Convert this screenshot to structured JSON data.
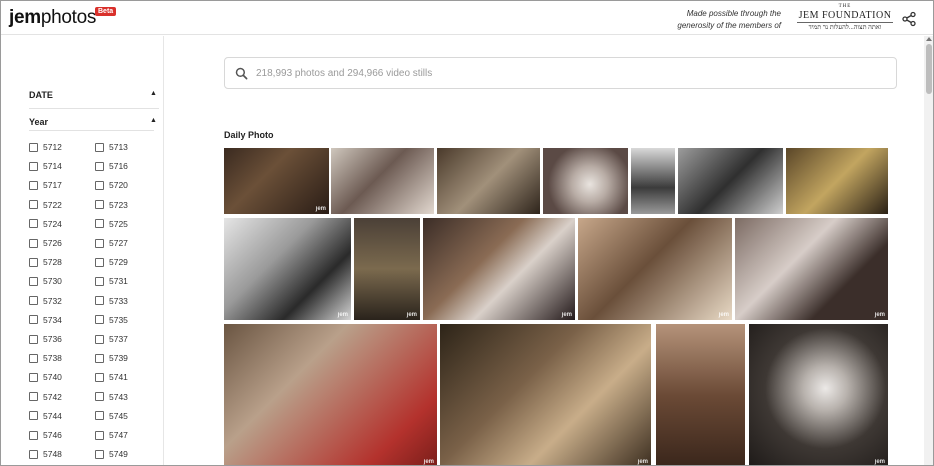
{
  "header": {
    "logo_bold": "jem",
    "logo_light": "photos",
    "beta_badge": "Beta",
    "sponsor_line1": "Made possible through the",
    "sponsor_line2": "generosity of the members of",
    "foundation_the": "THE",
    "foundation_name": "JEM FOUNDATION",
    "foundation_hebrew": "ואתה תצוה...להעלות נר תמיד",
    "share_icon": "share-icon"
  },
  "sidebar": {
    "date_label": "DATE",
    "year_label": "Year",
    "years": [
      "5712",
      "5713",
      "5714",
      "5716",
      "5717",
      "5720",
      "5722",
      "5723",
      "5724",
      "5725",
      "5726",
      "5727",
      "5728",
      "5729",
      "5730",
      "5731",
      "5732",
      "5733",
      "5734",
      "5735",
      "5736",
      "5737",
      "5738",
      "5739",
      "5740",
      "5741",
      "5742",
      "5743",
      "5744",
      "5745",
      "5746",
      "5747",
      "5748",
      "5749"
    ]
  },
  "search": {
    "placeholder": "218,993 photos and 294,966 video stills",
    "icon": "search-icon"
  },
  "main": {
    "section_title": "Daily Photo",
    "watermark": "jem"
  },
  "colors": {
    "beta_red": "#d9302b",
    "border_gray": "#d8d8d8"
  }
}
